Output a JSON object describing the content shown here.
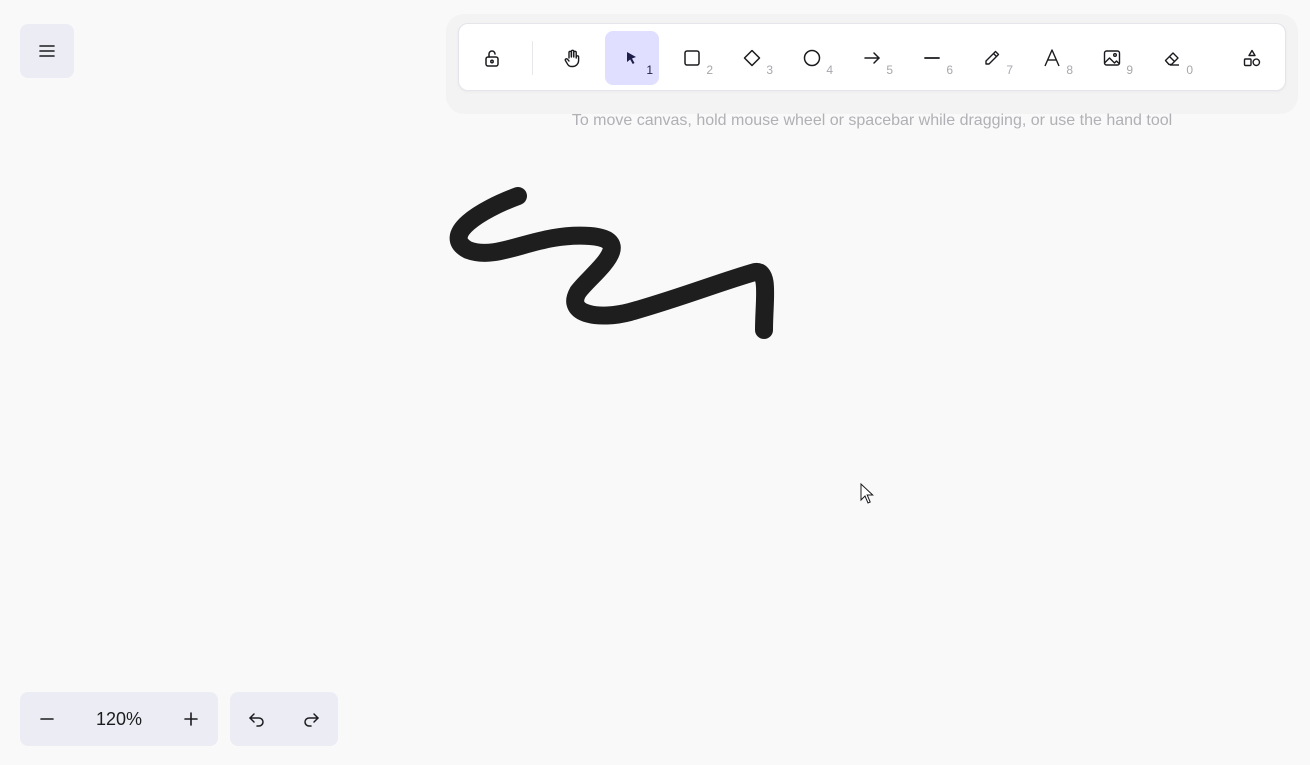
{
  "menu": {
    "icon": "hamburger-icon"
  },
  "toolbar": {
    "tools": [
      {
        "name": "lock",
        "icon": "lock-open-icon",
        "key": ""
      },
      {
        "name": "hand",
        "icon": "hand-icon",
        "key": ""
      },
      {
        "name": "selection",
        "icon": "pointer-icon",
        "key": "1",
        "active": true
      },
      {
        "name": "rectangle",
        "icon": "rectangle-icon",
        "key": "2"
      },
      {
        "name": "diamond",
        "icon": "diamond-icon",
        "key": "3"
      },
      {
        "name": "ellipse",
        "icon": "ellipse-icon",
        "key": "4"
      },
      {
        "name": "arrow",
        "icon": "arrow-icon",
        "key": "5"
      },
      {
        "name": "line",
        "icon": "line-icon",
        "key": "6"
      },
      {
        "name": "draw",
        "icon": "pencil-icon",
        "key": "7"
      },
      {
        "name": "text",
        "icon": "text-icon",
        "key": "8"
      },
      {
        "name": "image",
        "icon": "image-icon",
        "key": "9"
      },
      {
        "name": "eraser",
        "icon": "eraser-icon",
        "key": "0"
      },
      {
        "name": "library",
        "icon": "shapes-icon",
        "key": ""
      }
    ]
  },
  "hint": "To move canvas, hold mouse wheel or spacebar while dragging, or use the hand tool",
  "zoom": {
    "level": "120%",
    "decrease_icon": "minus-icon",
    "increase_icon": "plus-icon"
  },
  "history": {
    "undo_icon": "undo-icon",
    "redo_icon": "redo-icon"
  },
  "colors": {
    "accent": "#e0dfff",
    "stroke": "#1e1e1e",
    "hint": "#b0b0b5",
    "panel": "#ececf4"
  }
}
